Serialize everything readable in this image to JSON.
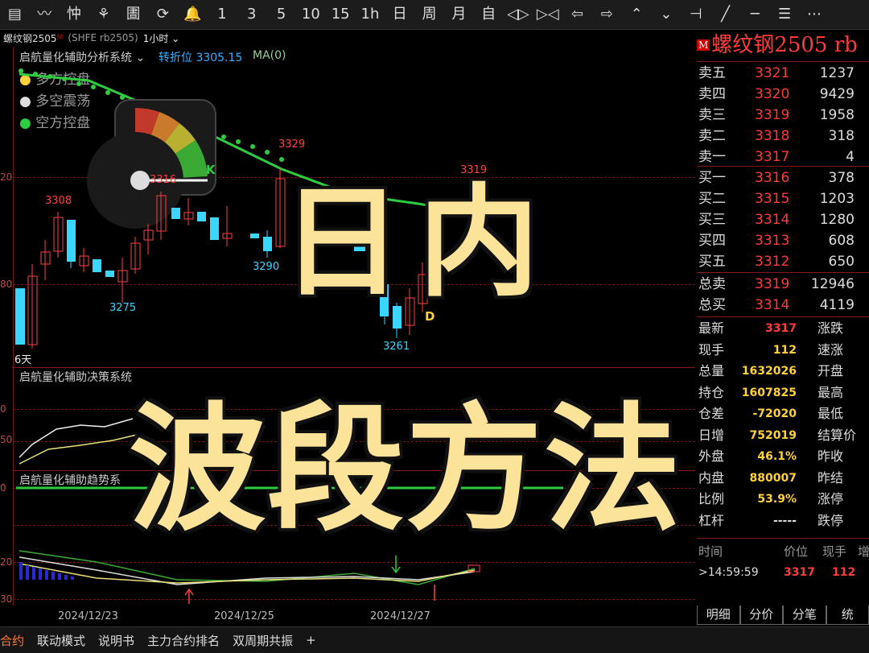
{
  "toolbar": {
    "items": [
      "▤",
      "〰",
      "忡",
      "⚘",
      "圕",
      "⟳",
      "🔔",
      "1",
      "3",
      "5",
      "10",
      "15",
      "1h",
      "日",
      "周",
      "月",
      "自",
      "◁▷",
      "▷◁",
      "⇦",
      "⇨",
      "⌃",
      "⌄",
      "⊣",
      "╱",
      "─",
      "☰",
      "⋯"
    ]
  },
  "title": {
    "name": "螺纹钢2505",
    "marker": "M",
    "code": "(SHFE rb2505)",
    "period": "1小时"
  },
  "main_panel": {
    "system": "启航量化辅助分析系统",
    "ind1": "转折位 3305.15",
    "ind2": "MA(0)",
    "legend": [
      "多方控盘",
      "多空震荡",
      "空方控盘"
    ],
    "labels": {
      "p3329": "3329",
      "p3316": "3316",
      "p3308": "3308",
      "p3290": "3290",
      "p3275": "3275",
      "p3261": "3261",
      "p3319": "3319",
      "d": "D",
      "k": "K",
      "days": "6天"
    }
  },
  "panel2": {
    "system": "启航量化辅助决策系统"
  },
  "panel3": {
    "system": "启航量化辅助趋势系"
  },
  "axis_labels": [
    "20",
    "80",
    "0",
    "50",
    "0",
    "20",
    "30"
  ],
  "dates": [
    "2024/12/23",
    "2024/12/25",
    "2024/12/27"
  ],
  "bottom_bar": [
    "合约",
    "联动模式",
    "说明书",
    "主力合约排名",
    "双周期共振",
    "+"
  ],
  "quote": {
    "title": "螺纹钢2505 rb",
    "marker": "M",
    "asks": [
      {
        "label": "卖五",
        "price": "3321",
        "vol": "1237"
      },
      {
        "label": "卖四",
        "price": "3320",
        "vol": "9429"
      },
      {
        "label": "卖三",
        "price": "3319",
        "vol": "1958"
      },
      {
        "label": "卖二",
        "price": "3318",
        "vol": "318"
      },
      {
        "label": "卖一",
        "price": "3317",
        "vol": "4"
      }
    ],
    "bids": [
      {
        "label": "买一",
        "price": "3316",
        "vol": "378"
      },
      {
        "label": "买二",
        "price": "3315",
        "vol": "1203"
      },
      {
        "label": "买三",
        "price": "3314",
        "vol": "1280"
      },
      {
        "label": "买四",
        "price": "3313",
        "vol": "608"
      },
      {
        "label": "买五",
        "price": "3312",
        "vol": "650"
      }
    ],
    "totals": [
      {
        "label": "总卖",
        "price": "3319",
        "vol": "12946"
      },
      {
        "label": "总买",
        "price": "3314",
        "vol": "4119"
      }
    ],
    "info": [
      {
        "label": "最新",
        "value": "3317",
        "color": "#ff3b3b",
        "key": "涨跌"
      },
      {
        "label": "现手",
        "value": "112",
        "color": "#ffd23a",
        "key": "速涨"
      },
      {
        "label": "总量",
        "value": "1632026",
        "color": "#ffd23a",
        "key": "开盘"
      },
      {
        "label": "持仓",
        "value": "1607825",
        "color": "#ffd23a",
        "key": "最高"
      },
      {
        "label": "仓差",
        "value": "-72020",
        "color": "#ffd23a",
        "key": "最低"
      },
      {
        "label": "日增",
        "value": "752019",
        "color": "#ffd23a",
        "key": "结算价"
      },
      {
        "label": "外盘",
        "value": "46.1%",
        "color": "#ffd23a",
        "key": "昨收"
      },
      {
        "label": "内盘",
        "value": "880007",
        "color": "#ffd23a",
        "key": "昨结"
      },
      {
        "label": "比例",
        "value": "53.9%",
        "color": "#ffd23a",
        "key": "涨停"
      },
      {
        "label": "杠杆",
        "value": "-----",
        "color": "#ddd",
        "key": "跌停"
      }
    ],
    "trade_header": {
      "time": "时间",
      "price": "价位",
      "hand": "现手",
      "inc": "增"
    },
    "trade_row": {
      "time": ">14:59:59",
      "price": "3317",
      "hand": "112"
    },
    "tabs": [
      "明细",
      "分价",
      "分笔",
      "统"
    ]
  },
  "overlay": {
    "line1": "日内",
    "line2": "波段方法"
  }
}
